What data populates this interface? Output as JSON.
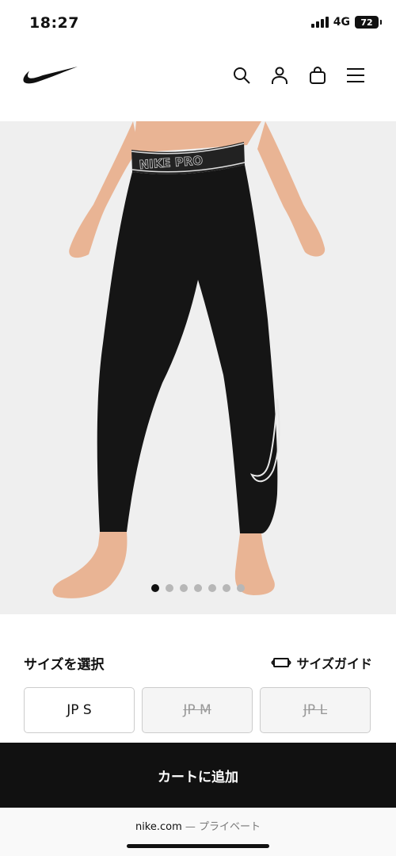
{
  "status_bar": {
    "time": "18:27",
    "network": "4G",
    "battery": "72"
  },
  "header": {
    "logo": "nike-swoosh",
    "icons": [
      "search-icon",
      "account-icon",
      "bag-icon",
      "menu-icon"
    ]
  },
  "product_image": {
    "waistband_text": "NIKE PRO",
    "carousel_total": 7,
    "carousel_active": 1
  },
  "size_section": {
    "title": "サイズを選択",
    "guide_label": "サイズガイド",
    "sizes": [
      {
        "label": "JP S",
        "available": true
      },
      {
        "label": "JP M",
        "available": false
      },
      {
        "label": "JP L",
        "available": false
      }
    ]
  },
  "cart": {
    "button_label": "カートに追加"
  },
  "browser": {
    "domain": "nike.com",
    "separator": " — ",
    "mode": "プライベート"
  },
  "colors": {
    "accent": "#111111",
    "hero_bg": "#efefef",
    "skin": "#e9b494"
  }
}
